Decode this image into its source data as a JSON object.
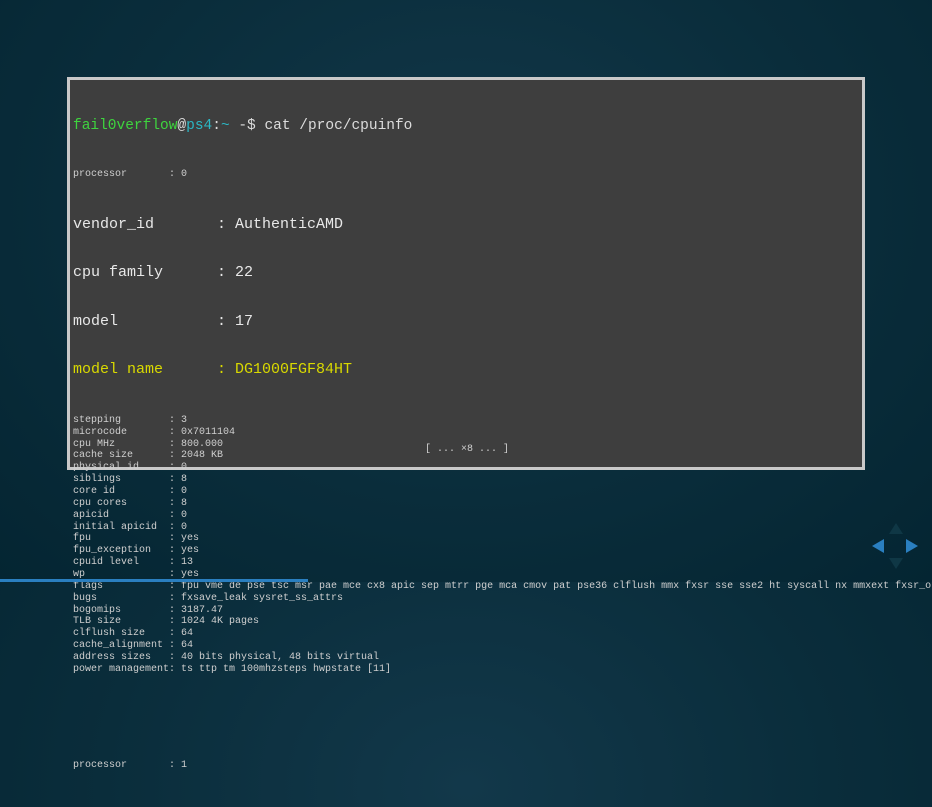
{
  "terminal": {
    "prompt": {
      "user": "fail0verflow",
      "at": "@",
      "host": "ps4",
      "sep": ":",
      "path": "~",
      "symbol": " -$",
      "command": " cat /proc/cpuinfo"
    },
    "header_line": "processor       : 0",
    "big_lines": [
      "vendor_id       : AuthenticAMD",
      "cpu family      : 22",
      "model           : 17"
    ],
    "highlight_line": "model name      : DG1000FGF84HT",
    "lines": [
      "stepping        : 3",
      "microcode       : 0x7011104",
      "cpu MHz         : 800.000",
      "cache size      : 2048 KB",
      "physical id     : 0",
      "siblings        : 8",
      "core id         : 0",
      "cpu cores       : 8",
      "apicid          : 0",
      "initial apicid  : 0",
      "fpu             : yes",
      "fpu_exception   : yes",
      "cpuid level     : 13",
      "wp              : yes",
      "flags           : fpu vme de pse tsc msr pae mce cx8 apic sep mtrr pge mca cmov pat pse36 clflush mmx fxsr sse sse2 ht syscall nx mmxext fxsr_opt",
      "bugs            : fxsave_leak sysret_ss_attrs",
      "bogomips        : 3187.47",
      "TLB size        : 1024 4K pages",
      "clflush size    : 64",
      "cache_alignment : 64",
      "address sizes   : 40 bits physical, 48 bits virtual",
      "power management: ts ttp tm 100mhzsteps hwpstate [11]"
    ],
    "next_line": "processor       : 1",
    "more": "[ ... ×8 ... ]"
  },
  "navigation": {
    "left_icon": "arrow-left",
    "right_icon": "arrow-right",
    "up_icon": "arrow-up",
    "down_icon": "arrow-down",
    "accent": "#2a7fc0"
  },
  "progress": {
    "percent": 33
  }
}
